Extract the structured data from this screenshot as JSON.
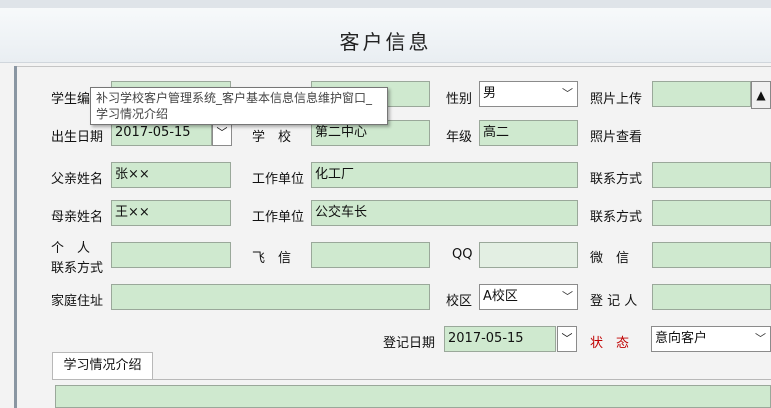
{
  "window": {
    "title": "客户信息"
  },
  "tooltip": {
    "text": "补习学校客户管理系统_客户基本信息信息维护窗口_学习情况介绍"
  },
  "row1": {
    "student_no_label": "学生编号",
    "student_no_value": "",
    "name_value": "",
    "gender_label": "性别",
    "gender_value": "男",
    "photo_upload_label": "照片上传",
    "photo_path_value": "",
    "scroll_glyph": "▲"
  },
  "row2": {
    "birth_label": "出生日期",
    "birth_value": "2017-05-15",
    "school_label": "学　校",
    "school_value": "第二中心",
    "grade_label": "年级",
    "grade_value": "高二",
    "photo_view_label": "照片查看"
  },
  "row3": {
    "father_label": "父亲姓名",
    "father_value": "张××",
    "work_label": "工作单位",
    "work_value": "化工厂",
    "contact_label": "联系方式",
    "contact_value": ""
  },
  "row4": {
    "mother_label": "母亲姓名",
    "mother_value": "王××",
    "work_label": "工作单位",
    "work_value": "公交车长",
    "contact_label": "联系方式",
    "contact_value": ""
  },
  "row5": {
    "personal_label_1": "个　人",
    "personal_label_2": "联系方式",
    "personal_value": "",
    "fetion_label": "飞　信",
    "fetion_value": "",
    "qq_label": "QQ",
    "qq_value": "",
    "wechat_label": "微　信",
    "wechat_value": ""
  },
  "row6": {
    "address_label": "家庭住址",
    "address_value": "",
    "campus_label": "校区",
    "campus_value": "A校区",
    "registrar_label": "登 记 人",
    "registrar_value": ""
  },
  "row7": {
    "reg_date_label": "登记日期",
    "reg_date_value": "2017-05-15",
    "status_label": "状　态",
    "status_value": "意向客户"
  },
  "tabs": {
    "study_intro_label": "学习情况介绍"
  },
  "icons": {
    "dropdown": "chevron-down-icon"
  },
  "colors": {
    "field_bg": "#cfe9cf",
    "status_label": "#c00000"
  }
}
